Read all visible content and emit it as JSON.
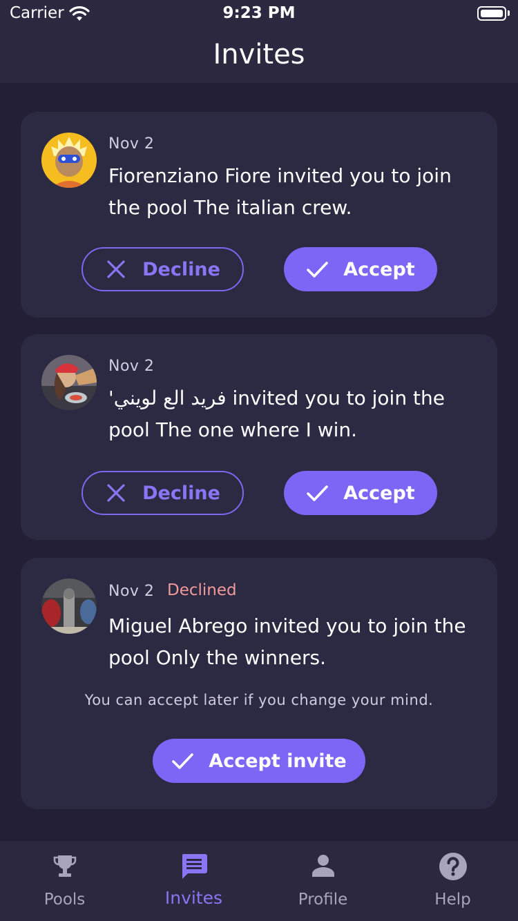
{
  "status_bar": {
    "carrier": "Carrier",
    "time": "9:23 PM"
  },
  "header": {
    "title": "Invites"
  },
  "invites": [
    {
      "date": "Nov 2",
      "status": "",
      "message": "Fiorenziano Fiore invited you to join the pool The italian crew.",
      "decline_label": "Decline",
      "accept_label": "Accept"
    },
    {
      "date": "Nov 2",
      "status": "",
      "message": "'فريد الع لويني invited you to join the pool The one where I win.",
      "decline_label": "Decline",
      "accept_label": "Accept"
    },
    {
      "date": "Nov 2",
      "status": "Declined",
      "message": "Miguel Abrego invited you to join the pool Only the winners.",
      "note": "You can accept later if you change your mind.",
      "accept_label": "Accept invite"
    }
  ],
  "tab_bar": {
    "active": "Invites",
    "tabs": [
      {
        "label": "Pools",
        "icon": "trophy-icon"
      },
      {
        "label": "Invites",
        "icon": "chat-icon"
      },
      {
        "label": "Profile",
        "icon": "person-icon"
      },
      {
        "label": "Help",
        "icon": "help-icon"
      }
    ]
  },
  "colors": {
    "background": "#232035",
    "card": "#2c2942",
    "accent": "#7d66f5",
    "declined": "#f09a9a"
  }
}
